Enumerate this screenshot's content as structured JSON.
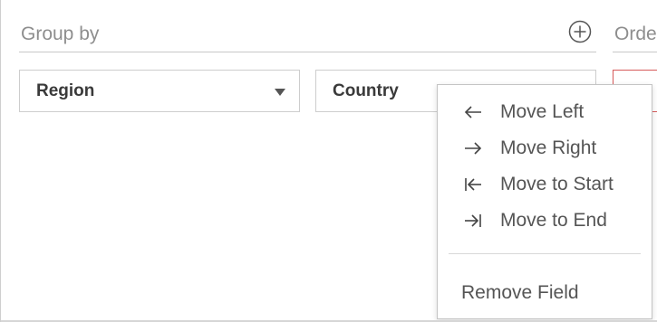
{
  "group_by": {
    "title": "Group by",
    "add_icon": "plus-circle-icon",
    "fields": [
      {
        "label": "Region",
        "icon": "chevron-down-icon"
      },
      {
        "label": "Country"
      }
    ]
  },
  "order_by": {
    "title": "Order"
  },
  "context_menu": {
    "items": [
      {
        "label": "Move Left",
        "icon": "arrow-left-icon"
      },
      {
        "label": "Move Right",
        "icon": "arrow-right-icon"
      },
      {
        "label": "Move to Start",
        "icon": "arrow-to-start-icon"
      },
      {
        "label": "Move to End",
        "icon": "arrow-to-end-icon"
      }
    ],
    "remove_label": "Remove Field"
  },
  "colors": {
    "order_field_border": "#d65a5a",
    "heading_text": "#8e8e8e",
    "menu_text": "#555555"
  }
}
